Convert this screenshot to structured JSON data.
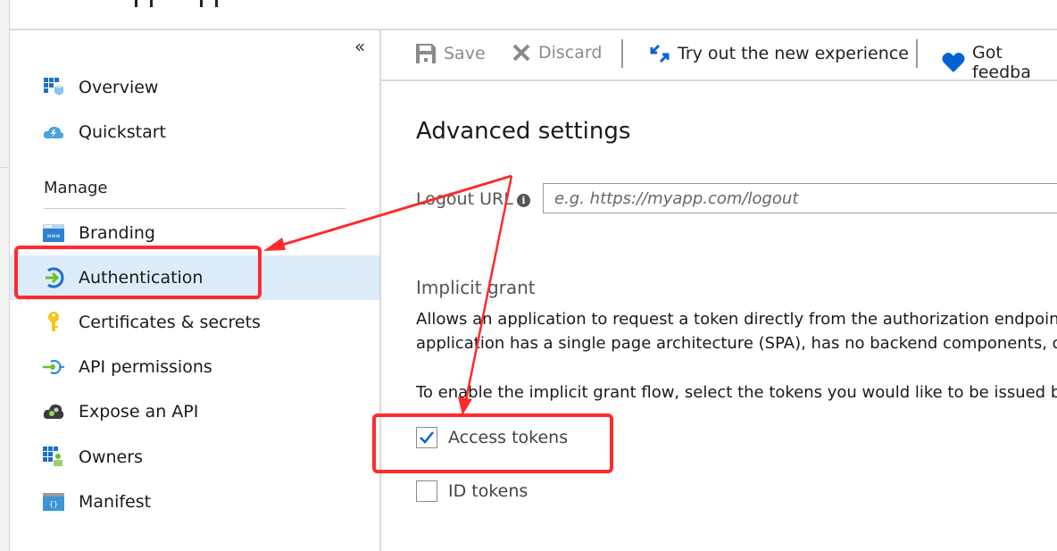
{
  "sidebar": {
    "collapse_glyph": "«",
    "items_top": [
      {
        "label": "Overview",
        "icon": "overview-grid-icon"
      },
      {
        "label": "Quickstart",
        "icon": "quickstart-cloud-icon"
      }
    ],
    "section_label": "Manage",
    "items_manage": [
      {
        "label": "Branding",
        "icon": "branding-www-icon"
      },
      {
        "label": "Authentication",
        "icon": "authentication-icon",
        "active": true
      },
      {
        "label": "Certificates & secrets",
        "icon": "key-icon"
      },
      {
        "label": "API permissions",
        "icon": "api-permissions-icon"
      },
      {
        "label": "Expose an API",
        "icon": "expose-api-cloud-icon"
      },
      {
        "label": "Owners",
        "icon": "owners-icon"
      },
      {
        "label": "Manifest",
        "icon": "manifest-icon"
      }
    ]
  },
  "toolbar": {
    "save_label": "Save",
    "discard_label": "Discard",
    "try_label": "Try out the new experience",
    "feedback_label": "Got feedba"
  },
  "main": {
    "title": "Advanced settings",
    "logout_url": {
      "label": "Logout URL",
      "info_glyph": "i",
      "value": "",
      "placeholder": "e.g. https://myapp.com/logout"
    },
    "implicit_grant": {
      "heading": "Implicit grant",
      "description_line1": "Allows an application to request a token directly from the authorization endpoin",
      "description_line2": "application has a single page architecture (SPA), has no backend components, o",
      "instruction": "To enable the implicit grant flow, select the tokens you would like to be issued b",
      "checkboxes": [
        {
          "label": "Access tokens",
          "checked": true
        },
        {
          "label": "ID tokens",
          "checked": false
        }
      ]
    }
  },
  "annotations": {
    "highlight_color": "#ff2a2a"
  },
  "colors": {
    "accent": "#0063d1",
    "active_bg": "#dcecfb"
  }
}
